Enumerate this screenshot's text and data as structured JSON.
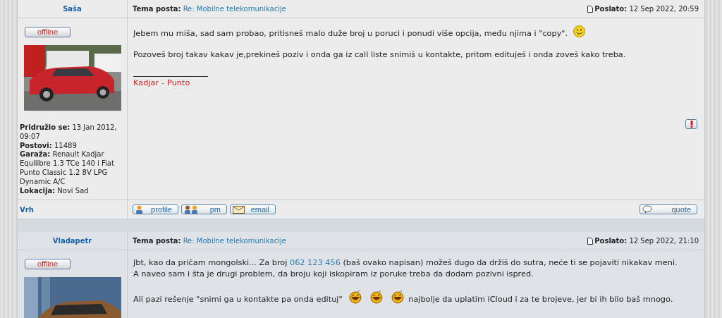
{
  "posts": [
    {
      "author": "Saša",
      "topic_label": "Tema posta:",
      "topic": "Re: Mobilne telekomunikacije",
      "posted_label": "Poslato:",
      "posted": "12 Sep 2022, 20:59",
      "status": "offline",
      "avatar": {
        "kind": "picture"
      },
      "profile": [
        "**Pridružio se:** 13 Jan 2012, 09:07",
        "**Postovi:** 11489",
        "**Garaža:** Renault Kadjar Equilibre 1.3 TCe 140 i Fiat Punto Classic 1.2 8V LPG Dynamic A/C",
        "**Lokacija:** Novi Sad"
      ],
      "paragraphs": [
        {
          "lines": [
            [
              {
                "kind": "text",
                "text": "Jebem mu miša, sad sam probao, pritisneš malo duže broj u poruci i ponudi više opcija, među njima i \"copy\"."
              },
              {
                "kind": "smiley"
              }
            ]
          ]
        },
        {
          "lines": [
            [
              {
                "kind": "text",
                "text": "Pozoveš broj takav kakav je,prekineš poziv i onda ga iz call liste snimiš u kontakte, pritom edituješ i onda zoveš kako treba."
              }
            ]
          ]
        }
      ],
      "signature": [
        {
          "kind": "link",
          "text": "Kadjar"
        },
        {
          "kind": "sep",
          "text": "-"
        },
        {
          "kind": "link",
          "text": "Punto"
        }
      ],
      "back_link": "Vrh",
      "buttons": [
        {
          "kind": "profile",
          "label": "profile"
        },
        {
          "kind": "pm",
          "label": "pm"
        },
        {
          "kind": "email",
          "label": "email"
        }
      ],
      "quote": "quote"
    },
    {
      "author": "Vladapetr",
      "topic_label": "Tema posta:",
      "topic": "Re: Mobilne telekomunikacije",
      "posted_label": "Poslato:",
      "posted": "12 Sep 2022, 21:10",
      "status": "offline",
      "avatar": {
        "kind": "picture"
      },
      "paragraphs": [
        {
          "lines": [
            [
              {
                "kind": "text",
                "text": "Jbt, kao da pričam mongolski... Za broj"
              },
              {
                "kind": "link",
                "text": "062 123 456"
              },
              {
                "kind": "text",
                "text": "(baš ovako napisan) možeš dugo da držiš do sutra, neće ti se pojaviti nikakav meni."
              }
            ],
            [
              {
                "kind": "text",
                "text": "A naveo sam i šta je drugi problem, da broju koji iskopiram iz poruke treba da dodam pozivni ispred."
              }
            ]
          ]
        },
        {
          "lines": [
            [
              {
                "kind": "text",
                "text": "Ali pazi rešenje \"snimi ga u kontakte pa onda edituj\""
              },
              {
                "kind": "laugh"
              },
              {
                "kind": "laugh"
              },
              {
                "kind": "laugh"
              },
              {
                "kind": "text",
                "text": "najbolje da uplatim iCloud i za te brojeve, jer bi ih bilo baš mnogo."
              }
            ]
          ]
        }
      ]
    }
  ]
}
